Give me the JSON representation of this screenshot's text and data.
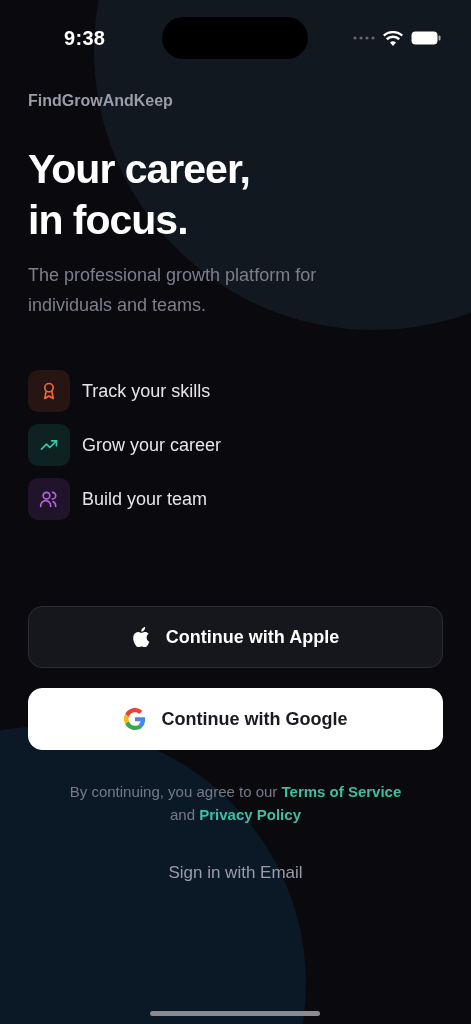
{
  "status_bar": {
    "time": "9:38"
  },
  "brand": "FindGrowAndKeep",
  "headline": [
    "Your career,",
    "in focus."
  ],
  "subtitle": "The professional growth platform for individuals and teams.",
  "features": [
    {
      "kind": "award",
      "label": "Track your skills",
      "color": "#f06a35"
    },
    {
      "kind": "trend",
      "label": "Grow your career",
      "color": "#3cc7a6"
    },
    {
      "kind": "users",
      "label": "Build your team",
      "color": "#b565d8"
    }
  ],
  "buttons": [
    {
      "kind": "apple",
      "label": "Continue with Apple"
    },
    {
      "kind": "google",
      "label": "Continue with Google"
    }
  ],
  "legal": {
    "before": "By continuing, you agree to our",
    "terms_link": "Terms of Service",
    "middle": "and",
    "privacy_link": "Privacy Policy"
  },
  "email_link": "Sign in with Email"
}
